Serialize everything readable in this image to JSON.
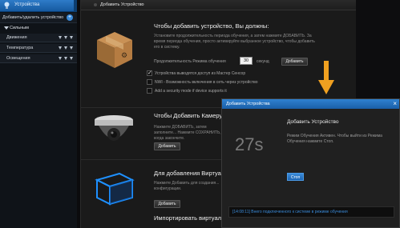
{
  "sidebar": {
    "header_title": "Устройства",
    "add_label": "Добавить/удалить устройство",
    "group_label": "Сильным",
    "items": [
      {
        "label": "Движения"
      },
      {
        "label": "Температура"
      },
      {
        "label": "Освещения"
      }
    ]
  },
  "main": {
    "tab_label": "Добавить Устройство",
    "section1": {
      "title": "Чтобы добавить устройство, Вы должны:",
      "description": "Установите продолжительность периода обучения, а затем нажмите ДОБАВИТЬ. За время периода обучения, просто активируйте выбранное устройство, чтобы добавить его в систему.",
      "duration_label": "Продолжительность Режима обучения",
      "duration_value": "30",
      "duration_unit": "секунд",
      "add_button": "Добавить",
      "options": [
        {
          "label": "Устройства выводятся доступ из Мастер Сенсор",
          "checked": true
        },
        {
          "label": "NWI - Возможность включения в сеть через устройство",
          "checked": false
        },
        {
          "label": "Add a security mode if device supports it",
          "checked": false
        }
      ]
    },
    "section2": {
      "title": "Чтобы Добавить Камеру:",
      "description": "Нажмите ДОБАВИТЬ, затем заполните... Нажмите СОХРАНИТЬ, когда закончите.",
      "add_button": "Добавить"
    },
    "section3": {
      "title": "Для добавления Виртуального...",
      "description": "Нажмите Добавить для создания... конфигурации.",
      "add_button": "Добавить",
      "import_title": "Импортировать виртуальн..."
    }
  },
  "dialog": {
    "title": "Добавить Устройства",
    "heading": "Добавить Устройство",
    "countdown": "27s",
    "text": "Режим Обучения Активен. Чтобы выйти из Режима Обучения нажмите Стоп.",
    "stop_button": "Стоп",
    "log": "[14:08:11] Внего подключенного к системе в режиме обучения"
  },
  "colors": {
    "accent_blue": "#2f81d0",
    "arrow_orange": "#f0a020"
  }
}
